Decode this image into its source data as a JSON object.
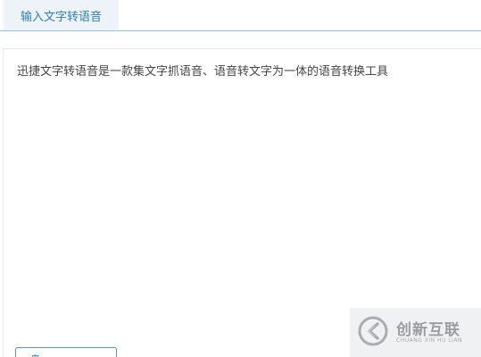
{
  "tabs": [
    {
      "label": "输入文字转语音",
      "active": true
    }
  ],
  "editor": {
    "text": "迅捷文字转语音是一款集文字抓语音、语音转文字为一体的语音转换工具"
  },
  "action_button": {
    "icon": "clipboard-icon",
    "label": ""
  },
  "watermark": {
    "title": "创新互联",
    "subtitle": "CHUANG XIN HU LIAN"
  },
  "colors": {
    "accent": "#2f7fb0",
    "tab_background": "#eef3f9",
    "border": "#8fc3e0",
    "text": "#444444"
  }
}
